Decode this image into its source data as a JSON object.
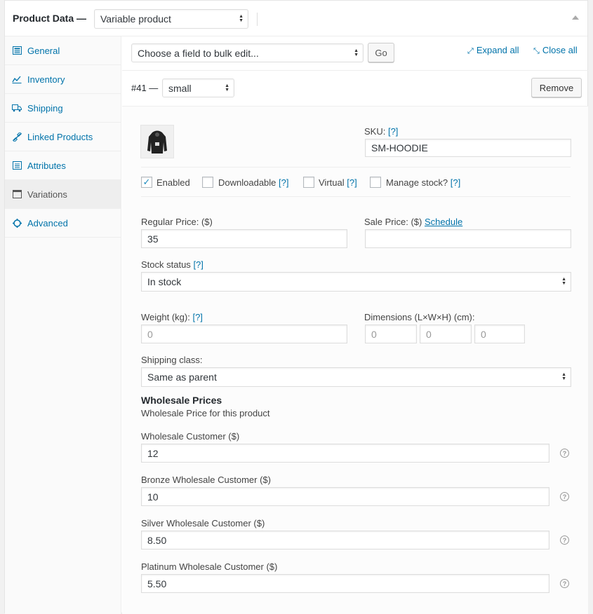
{
  "header": {
    "title": "Product Data —",
    "product_type": "Variable product"
  },
  "tabs": [
    {
      "label": "General",
      "icon": "general-icon"
    },
    {
      "label": "Inventory",
      "icon": "inventory-icon"
    },
    {
      "label": "Shipping",
      "icon": "truck-icon"
    },
    {
      "label": "Linked Products",
      "icon": "link-icon"
    },
    {
      "label": "Attributes",
      "icon": "list-icon"
    },
    {
      "label": "Variations",
      "icon": "window-icon"
    },
    {
      "label": "Advanced",
      "icon": "gear-icon"
    }
  ],
  "toolbar": {
    "bulk_edit": "Choose a field to bulk edit...",
    "go_label": "Go",
    "expand_all": "Expand all",
    "close_all": "Close all"
  },
  "variation": {
    "id_label": "#41 —",
    "attribute_value": "small",
    "remove_label": "Remove",
    "sku_label": "SKU:",
    "sku_help": "[?]",
    "sku_value": "SM-HOODIE",
    "enabled_label": "Enabled",
    "downloadable_label": "Downloadable",
    "downloadable_help": "[?]",
    "virtual_label": "Virtual",
    "virtual_help": "[?]",
    "manage_stock_label": "Manage stock?",
    "manage_stock_help": "[?]",
    "regular_price_label": "Regular Price: ($)",
    "regular_price_value": "35",
    "sale_price_label": "Sale Price: ($)",
    "schedule_label": "Schedule",
    "stock_status_label": "Stock status",
    "stock_status_help": "[?]",
    "stock_status_value": "In stock",
    "weight_label": "Weight (kg):",
    "weight_help": "[?]",
    "weight_placeholder": "0",
    "dimensions_label": "Dimensions (L×W×H) (cm):",
    "dim_l_placeholder": "0",
    "dim_w_placeholder": "0",
    "dim_h_placeholder": "0",
    "shipping_class_label": "Shipping class:",
    "shipping_class_value": "Same as parent",
    "wholesale_title": "Wholesale Prices",
    "wholesale_desc": "Wholesale Price for this product",
    "wholesale": [
      {
        "label": "Wholesale Customer ($)",
        "value": "12"
      },
      {
        "label": "Bronze Wholesale Customer ($)",
        "value": "10"
      },
      {
        "label": "Silver Wholesale Customer ($)",
        "value": "8.50"
      },
      {
        "label": "Platinum Wholesale Customer ($)",
        "value": "5.50"
      }
    ]
  },
  "colors": {
    "link": "#0073aa",
    "checkbox": "#1e8cbe"
  }
}
